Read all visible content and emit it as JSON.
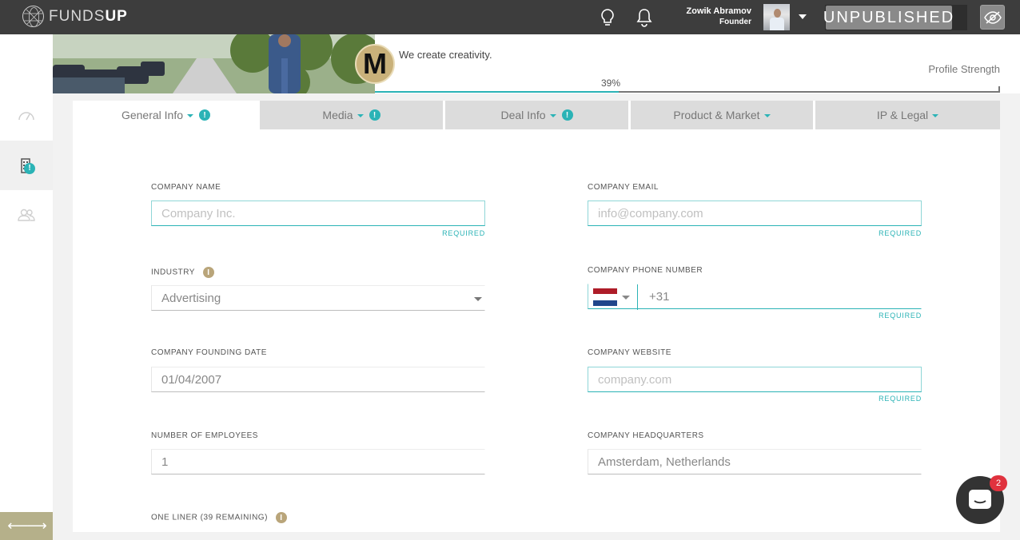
{
  "brand": {
    "name_light": "FUNDS",
    "name_bold": "UP"
  },
  "header": {
    "user_name": "Zowik Abramov",
    "user_role": "Founder",
    "status_button": "UNPUBLISHED"
  },
  "company": {
    "logo_letter": "M",
    "tagline": "We create creativity.",
    "profile_strength_label": "Profile Strength",
    "profile_strength_text": "39%",
    "profile_strength_value": 0.39
  },
  "tabs": [
    {
      "label": "General Info",
      "warning": "!"
    },
    {
      "label": "Media",
      "warning": "!"
    },
    {
      "label": "Deal Info",
      "warning": "!"
    },
    {
      "label": "Product & Market"
    },
    {
      "label": "IP & Legal"
    }
  ],
  "form": {
    "required_label": "REQUIRED",
    "info_glyph": "i",
    "company_name": {
      "label": "COMPANY NAME",
      "placeholder": "Company Inc."
    },
    "company_email": {
      "label": "COMPANY EMAIL",
      "placeholder": "info@company.com"
    },
    "industry": {
      "label": "INDUSTRY",
      "value": "Advertising"
    },
    "phone": {
      "label": "COMPANY PHONE NUMBER",
      "value": "+31"
    },
    "founding_date": {
      "label": "COMPANY FOUNDING DATE",
      "value": "01/04/2007"
    },
    "website": {
      "label": "COMPANY WEBSITE",
      "placeholder": "company.com"
    },
    "employees": {
      "label": "NUMBER OF EMPLOYEES",
      "value": "1"
    },
    "headquarters": {
      "label": "COMPANY HEADQUARTERS",
      "value": "Amsterdam, Netherlands"
    },
    "one_liner": {
      "label": "ONE LINER (39 REMAINING)"
    }
  },
  "sidebar": {
    "badge": "!",
    "collapse_label": "⟵⟶"
  },
  "chat": {
    "unread_count": "2"
  },
  "colors": {
    "accent": "#2bb3b6",
    "topbar": "#3d3d3d",
    "info": "#b9a57a",
    "badge": "#e0323e"
  }
}
